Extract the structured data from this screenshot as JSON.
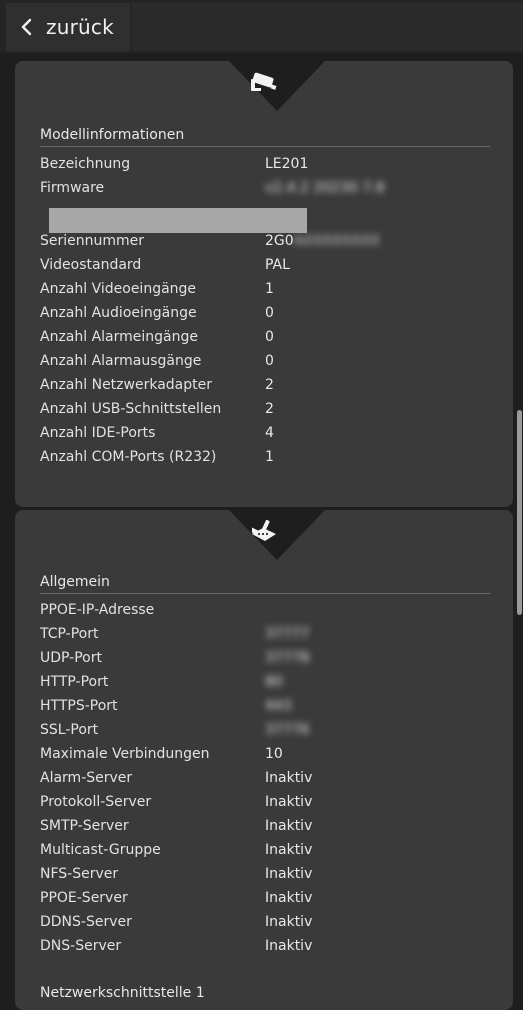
{
  "header": {
    "back_label": "zurück"
  },
  "model_section": {
    "icon": "camera-icon",
    "title": "Modellinformationen",
    "rows": [
      {
        "label": "Bezeichnung",
        "value": "LE201"
      },
      {
        "label": "Firmware",
        "value": "v2.4.2 20230 7.8"
      },
      {
        "label": "Seriennummer",
        "value": "2G0AXXXXXXX"
      },
      {
        "label": "Videostandard",
        "value": "PAL"
      },
      {
        "label": "Anzahl Videoeingänge",
        "value": "1"
      },
      {
        "label": "Anzahl Audioeingänge",
        "value": "0"
      },
      {
        "label": "Anzahl Alarmeingänge",
        "value": "0"
      },
      {
        "label": "Anzahl Alarmausgänge",
        "value": "0"
      },
      {
        "label": "Anzahl Netzwerkadapter",
        "value": "2"
      },
      {
        "label": "Anzahl USB-Schnittstellen",
        "value": "2"
      },
      {
        "label": "Anzahl IDE-Ports",
        "value": "4"
      },
      {
        "label": "Anzahl COM-Ports (R232)",
        "value": "1"
      }
    ]
  },
  "network_section": {
    "icon": "network-icon",
    "title": "Allgemein",
    "rows": [
      {
        "label": "PPOE-IP-Adresse",
        "value": ""
      },
      {
        "label": "TCP-Port",
        "value": "37777"
      },
      {
        "label": "UDP-Port",
        "value": "37778"
      },
      {
        "label": "HTTP-Port",
        "value": "80"
      },
      {
        "label": "HTTPS-Port",
        "value": "443"
      },
      {
        "label": "SSL-Port",
        "value": "37776"
      },
      {
        "label": "Maximale Verbindungen",
        "value": "10"
      },
      {
        "label": "Alarm-Server",
        "value": "Inaktiv"
      },
      {
        "label": "Protokoll-Server",
        "value": "Inaktiv"
      },
      {
        "label": "SMTP-Server",
        "value": "Inaktiv"
      },
      {
        "label": "Multicast-Gruppe",
        "value": "Inaktiv"
      },
      {
        "label": "NFS-Server",
        "value": "Inaktiv"
      },
      {
        "label": "PPOE-Server",
        "value": "Inaktiv"
      },
      {
        "label": "DDNS-Server",
        "value": "Inaktiv"
      },
      {
        "label": "DNS-Server",
        "value": "Inaktiv"
      }
    ],
    "next_title": "Netzwerkschnittstelle 1"
  }
}
